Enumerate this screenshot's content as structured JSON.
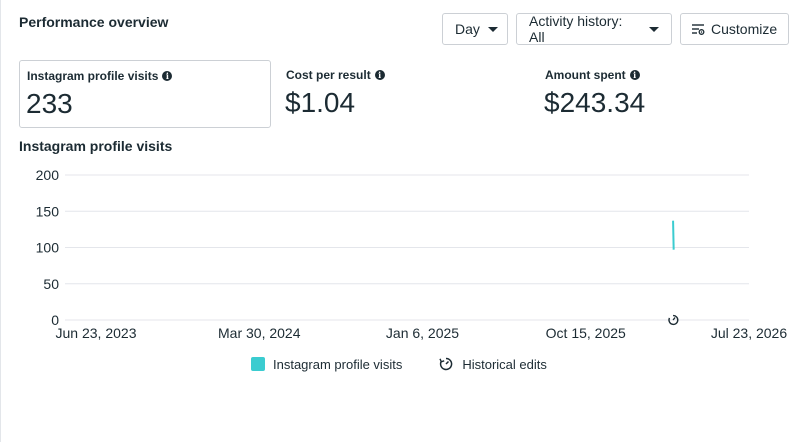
{
  "header": {
    "title": "Performance overview",
    "day_label": "Day",
    "activity_label": "Activity history: All",
    "customize_label": "Customize"
  },
  "metrics": [
    {
      "label": "Instagram profile visits",
      "value": "233",
      "selected": true
    },
    {
      "label": "Cost per result",
      "value": "$1.04",
      "selected": false
    },
    {
      "label": "Amount spent",
      "value": "$243.34",
      "selected": false
    }
  ],
  "chart_section": {
    "title": "Instagram profile visits"
  },
  "legend": {
    "series_label": "Instagram profile visits",
    "edits_label": "Historical edits"
  },
  "colors": {
    "series": "#3bccd0",
    "text": "#1c2b33",
    "grid": "#e4e6eb"
  },
  "chart_data": {
    "type": "line",
    "title": "Instagram profile visits",
    "xlabel": "",
    "ylabel": "",
    "ylim": [
      0,
      200
    ],
    "yticks": [
      0,
      50,
      100,
      150,
      200
    ],
    "xticks": [
      "Jun 23, 2023",
      "Mar 30, 2024",
      "Jan 6, 2025",
      "Oct 15, 2025",
      "Jul 23, 2026"
    ],
    "xrange": [
      "2023-06-23",
      "2026-07-23"
    ],
    "series": [
      {
        "name": "Instagram profile visits",
        "points": [
          {
            "x": "2026-03-20",
            "y": 137
          },
          {
            "x": "2026-03-21",
            "y": 97
          }
        ]
      }
    ],
    "annotations": [
      {
        "type": "historical-edit",
        "x": "2026-03-20"
      }
    ],
    "grid": true,
    "legend_position": "bottom"
  }
}
